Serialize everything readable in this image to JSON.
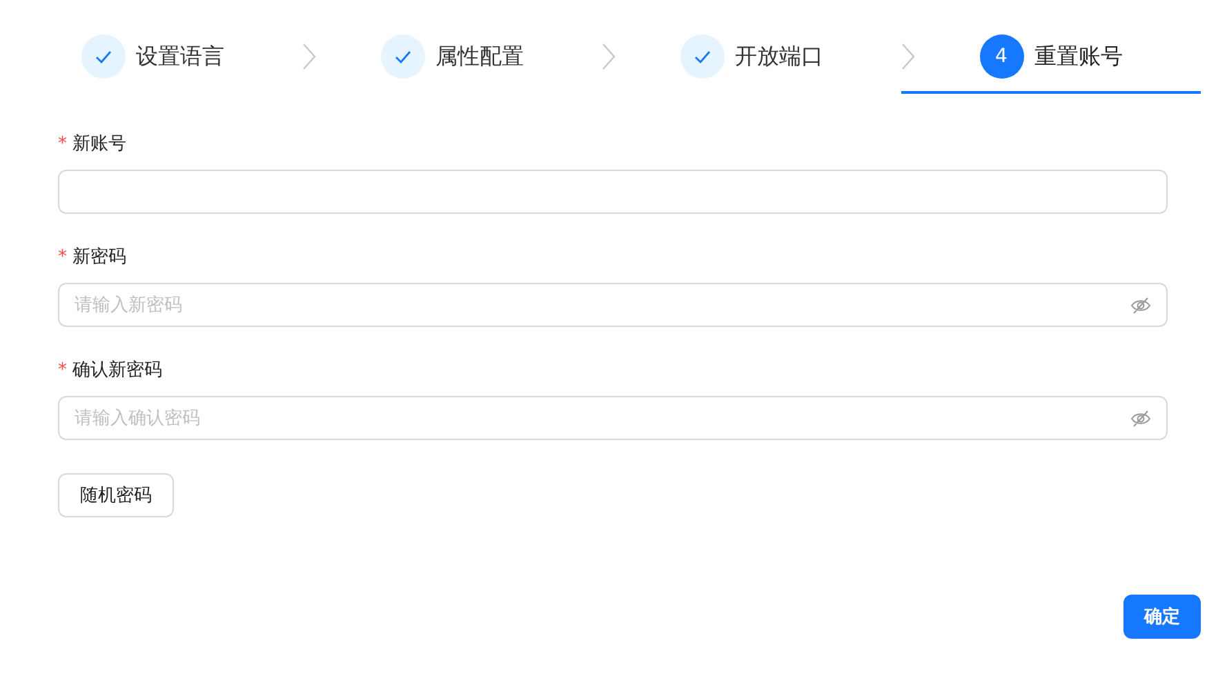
{
  "steps": [
    {
      "label": "设置语言",
      "kind": "done",
      "selected": false
    },
    {
      "label": "属性配置",
      "kind": "done",
      "selected": false
    },
    {
      "label": "开放端口",
      "kind": "done",
      "selected": false
    },
    {
      "label": "重置账号",
      "kind": "active",
      "number": "4",
      "selected": true
    }
  ],
  "form": {
    "fields": [
      {
        "required_mark": "*",
        "label": "新账号",
        "kind": "text"
      },
      {
        "required_mark": "*",
        "label": "新密码",
        "kind": "password",
        "placeholder": "请输入新密码"
      },
      {
        "required_mark": "*",
        "label": "确认新密码",
        "kind": "password",
        "placeholder": "请输入确认密码"
      }
    ],
    "random_button": "随机密码"
  },
  "confirm_button": "确定"
}
